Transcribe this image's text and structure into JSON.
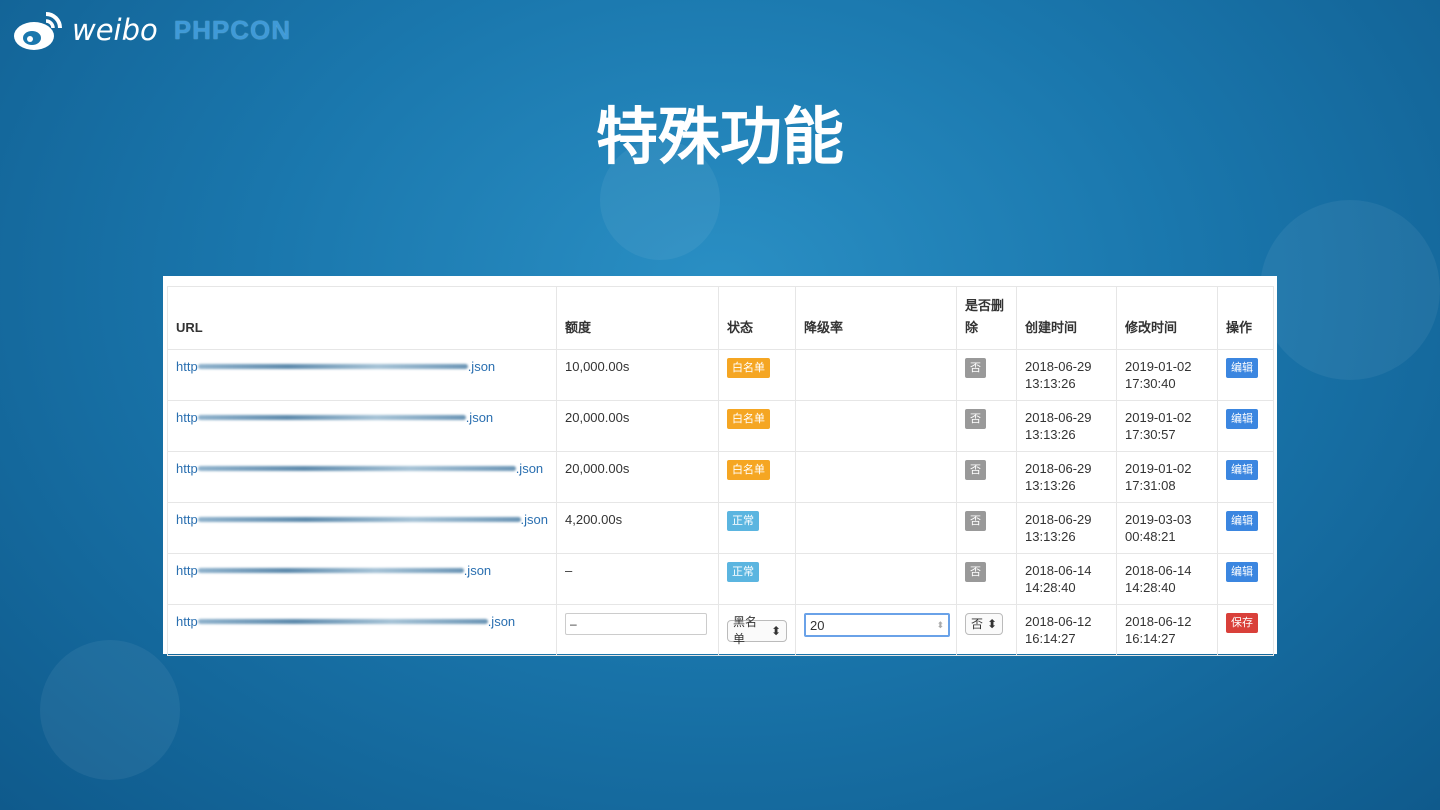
{
  "logo": {
    "weibo": "weibo",
    "phpcon": "PHPCON"
  },
  "title": "特殊功能",
  "table": {
    "headers": [
      "URL",
      "额度",
      "状态",
      "降级率",
      "是否删除",
      "创建时间",
      "修改时间",
      "操作"
    ],
    "rows": [
      {
        "url_prefix": "http",
        "url_suffix": ".json",
        "quota": "10,000.00s",
        "status": "白名单",
        "status_type": "warn",
        "rate": "",
        "deleted": "否",
        "created_date": "2018-06-29",
        "created_time": "13:13:26",
        "modified_date": "2019-01-02",
        "modified_time": "17:30:40",
        "action": "编辑"
      },
      {
        "url_prefix": "http",
        "url_suffix": ".json",
        "quota": "20,000.00s",
        "status": "白名单",
        "status_type": "warn",
        "rate": "",
        "deleted": "否",
        "created_date": "2018-06-29",
        "created_time": "13:13:26",
        "modified_date": "2019-01-02",
        "modified_time": "17:30:57",
        "action": "编辑"
      },
      {
        "url_prefix": "http",
        "url_suffix": ".json",
        "quota": "20,000.00s",
        "status": "白名单",
        "status_type": "warn",
        "rate": "",
        "deleted": "否",
        "created_date": "2018-06-29",
        "created_time": "13:13:26",
        "modified_date": "2019-01-02",
        "modified_time": "17:31:08",
        "action": "编辑"
      },
      {
        "url_prefix": "http",
        "url_suffix": ".json",
        "quota": "4,200.00s",
        "status": "正常",
        "status_type": "info",
        "rate": "",
        "deleted": "否",
        "created_date": "2018-06-29",
        "created_time": "13:13:26",
        "modified_date": "2019-03-03",
        "modified_time": "00:48:21",
        "action": "编辑"
      },
      {
        "url_prefix": "http",
        "url_suffix": ".json",
        "quota": "–",
        "status": "正常",
        "status_type": "info",
        "rate": "",
        "deleted": "否",
        "created_date": "2018-06-14",
        "created_time": "14:28:40",
        "modified_date": "2018-06-14",
        "modified_time": "14:28:40",
        "action": "编辑"
      }
    ],
    "edit_row": {
      "url_prefix": "http",
      "url_suffix": ".json",
      "quota_value": "–",
      "status_select": "黑名单",
      "rate_value": "20",
      "deleted_select": "否",
      "created_date": "2018-06-12",
      "created_time": "16:14:27",
      "modified_date": "2018-06-12",
      "modified_time": "16:14:27",
      "action": "保存"
    }
  }
}
